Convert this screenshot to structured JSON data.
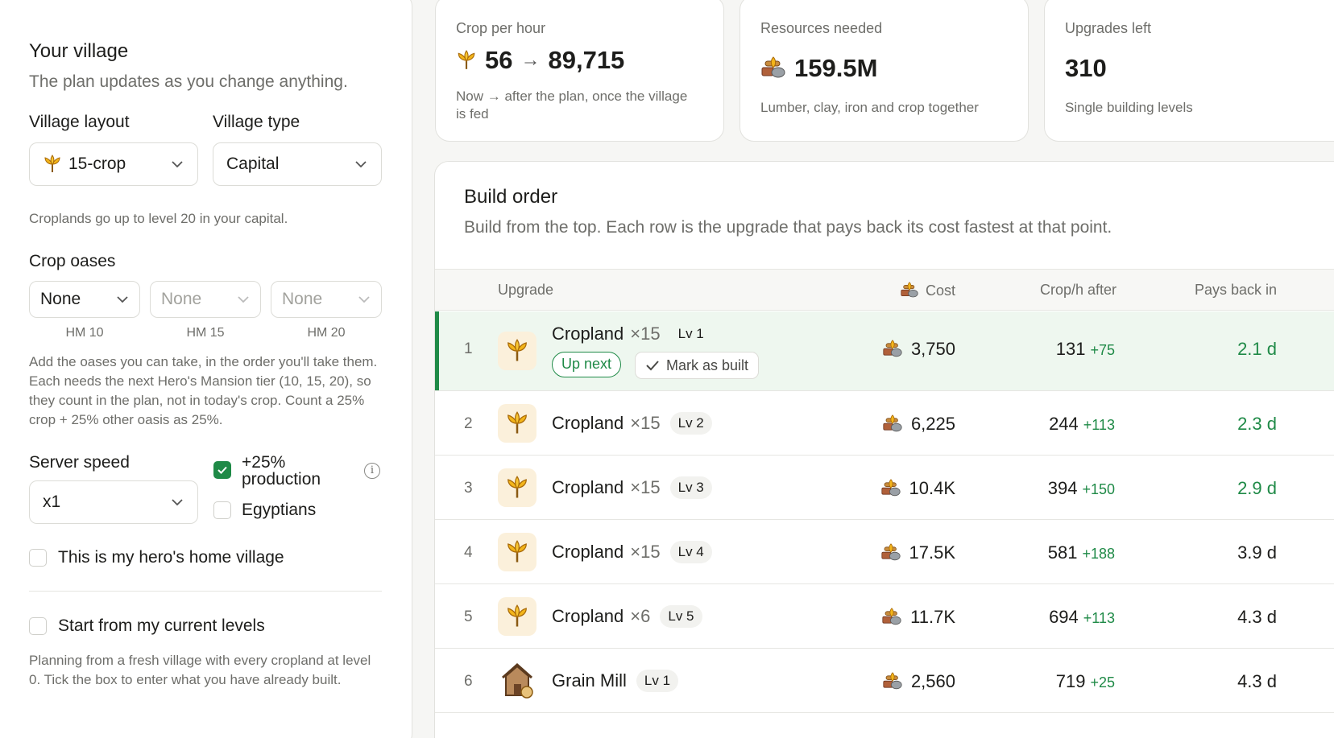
{
  "village": {
    "title": "Your village",
    "subtitle": "The plan updates as you change anything.",
    "layout_label": "Village layout",
    "layout_value": "15-crop",
    "type_label": "Village type",
    "type_value": "Capital",
    "capital_note": "Croplands go up to level 20 in your capital.",
    "oases_label": "Crop oases",
    "oases": [
      {
        "value": "None",
        "caption": "HM 10"
      },
      {
        "value": "None",
        "caption": "HM 15"
      },
      {
        "value": "None",
        "caption": "HM 20"
      }
    ],
    "oases_note": "Add the oases you can take, in the order you'll take them. Each needs the next Hero's Mansion tier (10, 15, 20), so they count in the plan, not in today's crop. Count a 25% crop + 25% other oasis as 25%.",
    "speed_label": "Server speed",
    "speed_value": "x1",
    "production_bonus": {
      "label": "+25% production",
      "checked": true
    },
    "egyptians": {
      "label": "Egyptians",
      "checked": false
    },
    "hero_home": {
      "label": "This is my hero's home village",
      "checked": false
    },
    "current_levels": {
      "label": "Start from my current levels",
      "checked": false
    },
    "current_levels_note": "Planning from a fresh village with every cropland at level 0. Tick the box to enter what you have already built."
  },
  "stats": {
    "crop": {
      "label": "Crop per hour",
      "now": "56",
      "arrow": "→",
      "after": "89,715",
      "note": "Now → after the plan, once the village is fed"
    },
    "resources": {
      "label": "Resources needed",
      "value": "159.5M",
      "note": "Lumber, clay, iron and crop together"
    },
    "upgrades": {
      "label": "Upgrades left",
      "value": "310",
      "note": "Single building levels"
    }
  },
  "build_order": {
    "title": "Build order",
    "subtitle": "Build from the top. Each row is the upgrade that pays back its cost fastest at that point.",
    "columns": {
      "upgrade": "Upgrade",
      "cost": "Cost",
      "croph": "Crop/h after",
      "pays": "Pays back in"
    },
    "up_next": "Up next",
    "mark_built": "Mark as built",
    "rows": [
      {
        "num": "1",
        "name": "Cropland",
        "mult": "×15",
        "level": "Lv 1",
        "cost": "3,750",
        "croph": "131",
        "delta": "+75",
        "pays": "2.1 d",
        "icon": "cropland"
      },
      {
        "num": "2",
        "name": "Cropland",
        "mult": "×15",
        "level": "Lv 2",
        "cost": "6,225",
        "croph": "244",
        "delta": "+113",
        "pays": "2.3 d",
        "icon": "cropland"
      },
      {
        "num": "3",
        "name": "Cropland",
        "mult": "×15",
        "level": "Lv 3",
        "cost": "10.4K",
        "croph": "394",
        "delta": "+150",
        "pays": "2.9 d",
        "icon": "cropland"
      },
      {
        "num": "4",
        "name": "Cropland",
        "mult": "×15",
        "level": "Lv 4",
        "cost": "17.5K",
        "croph": "581",
        "delta": "+188",
        "pays": "3.9 d",
        "icon": "cropland"
      },
      {
        "num": "5",
        "name": "Cropland",
        "mult": "×6",
        "level": "Lv 5",
        "cost": "11.7K",
        "croph": "694",
        "delta": "+113",
        "pays": "4.3 d",
        "icon": "cropland"
      },
      {
        "num": "6",
        "name": "Grain Mill",
        "mult": "",
        "level": "Lv 1",
        "cost": "2,560",
        "croph": "719",
        "delta": "+25",
        "pays": "4.3 d",
        "icon": "grain-mill"
      }
    ]
  }
}
